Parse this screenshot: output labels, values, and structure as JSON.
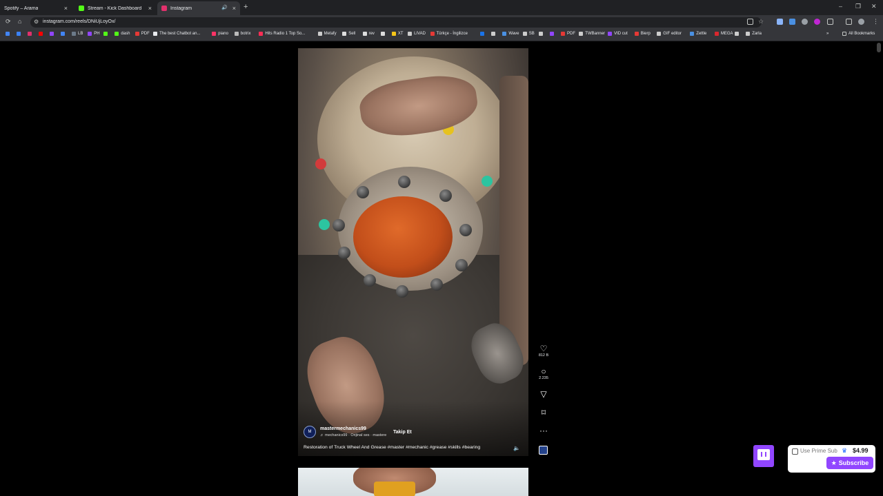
{
  "browser": {
    "tabs": [
      {
        "title": "Spotify – Arama",
        "favicon_color": "#1db954"
      },
      {
        "title": "Stream - Kick Dashboard",
        "favicon_color": "#53fc18"
      },
      {
        "title": "Instagram",
        "favicon_color": "#e1306c",
        "active": true
      }
    ],
    "new_tab_icon": "plus-icon",
    "url": "instagram.com/reels/DNiUjLoyOx/",
    "window_controls": {
      "minimize": "–",
      "restore": "❐",
      "close": "✕"
    }
  },
  "bookmarks": [
    {
      "label": "",
      "color": "#4285f4"
    },
    {
      "label": "",
      "color": "#3b82f6"
    },
    {
      "label": "",
      "color": "#e1306c"
    },
    {
      "label": "",
      "color": "#ff0000"
    },
    {
      "label": "",
      "color": "#9146ff"
    },
    {
      "label": "",
      "color": "#4285f4"
    },
    {
      "label": "LB",
      "color": "#6c7a89"
    },
    {
      "label": "PH",
      "color": "#9146ff"
    },
    {
      "label": "",
      "color": "#53fc18"
    },
    {
      "label": "dash",
      "color": "#53fc18"
    },
    {
      "label": "PDF",
      "color": "#e53935"
    },
    {
      "label": "The best Chatbot an...",
      "color": "#e8eaed"
    },
    {
      "label": "piano",
      "color": "#ff3366"
    },
    {
      "label": "botrix",
      "color": "#bbbbbb"
    },
    {
      "label": "Hits Radio 1 Top So...",
      "color": "#ff2d55"
    },
    {
      "label": "Metafy",
      "color": "#cccccc"
    },
    {
      "label": "Sell",
      "color": "#dddddd"
    },
    {
      "label": "rev",
      "color": "#dddddd"
    },
    {
      "label": "",
      "color": "#dddddd"
    },
    {
      "label": "XT",
      "color": "#f5c518"
    },
    {
      "label": "LIVAD",
      "color": "#cccccc"
    },
    {
      "label": "Türkçe - İngilizce",
      "color": "#e53935"
    },
    {
      "label": "",
      "color": "#1a73e8"
    },
    {
      "label": "",
      "color": "#cccccc"
    },
    {
      "label": "Wave",
      "color": "#4a90e2"
    },
    {
      "label": "SB",
      "color": "#cccccc"
    },
    {
      "label": "",
      "color": "#cccccc"
    },
    {
      "label": "",
      "color": "#9146ff"
    },
    {
      "label": "PDF",
      "color": "#e53935"
    },
    {
      "label": "TWBanner",
      "color": "#cccccc"
    },
    {
      "label": "VID cut",
      "color": "#9146ff"
    },
    {
      "label": "Bierp",
      "color": "#e53935"
    },
    {
      "label": "GIF editor",
      "color": "#cccccc"
    },
    {
      "label": "Zettle",
      "color": "#4a90e2"
    },
    {
      "label": "MEGA",
      "color": "#d9272e"
    },
    {
      "label": "",
      "color": "#cccccc"
    },
    {
      "label": "Zarla",
      "color": "#cccccc"
    }
  ],
  "bookmarks_overflow": "»",
  "all_bookmarks": "All Bookmarks",
  "reel": {
    "author": "mastermechanics99",
    "audio": "♬ mechanics99 · Orijinal ses · mastere",
    "follow": "Takip Et",
    "caption": "Restoration of Truck Wheel And Grease #master #mechanic #grease #skills #bearing",
    "likes": "812 B",
    "comments": "2.235",
    "avatar_text": "M"
  },
  "actions": {
    "like_icon": "heart-icon",
    "comment_icon": "comment-icon",
    "share_icon": "paper-plane-icon",
    "save_icon": "bookmark-icon",
    "more_icon": "more-icon"
  },
  "twitch": {
    "prime_label": "Use Prime Sub",
    "price": "$4.99",
    "subscribe": "Subscribe",
    "accent": "#9146ff"
  }
}
